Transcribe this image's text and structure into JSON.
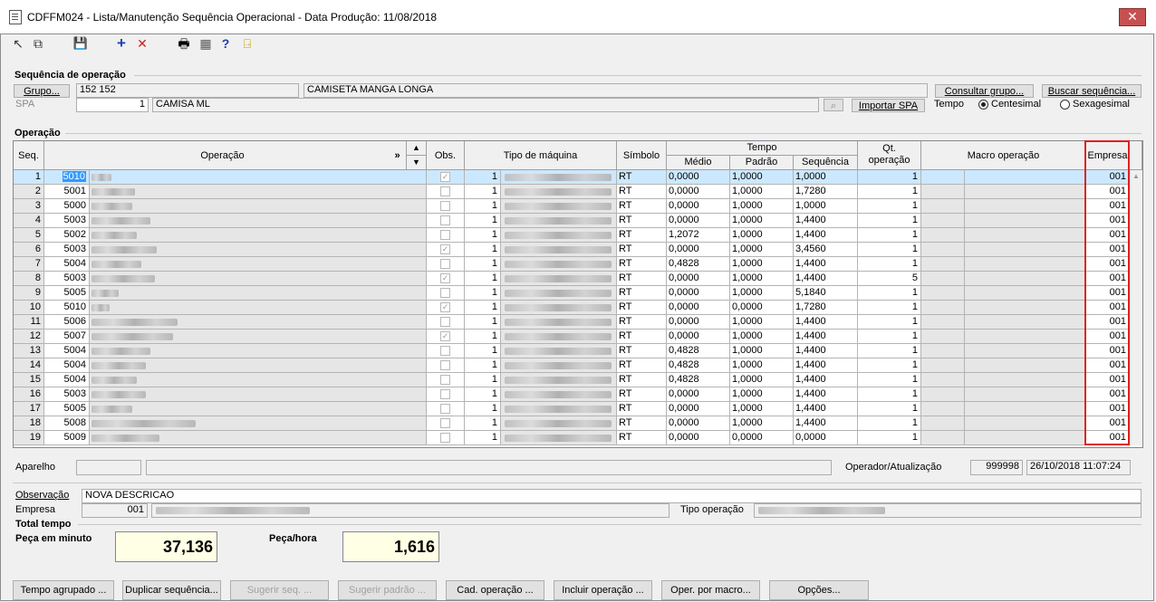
{
  "window": {
    "title": "CDFFM024 - Lista/Manutenção Sequência Operacional - Data Produção: 11/08/2018",
    "close": "✕"
  },
  "toolbar": [
    {
      "icon": "export-icon",
      "glyph": "↖"
    },
    {
      "icon": "copy-icon",
      "glyph": "⧉"
    },
    {
      "icon": "save-icon",
      "glyph": "💾"
    },
    {
      "icon": "add-icon",
      "glyph": "+"
    },
    {
      "icon": "delete-icon",
      "glyph": "✕"
    },
    {
      "icon": "print-icon",
      "glyph": "🖶"
    },
    {
      "icon": "calculator-icon",
      "glyph": "▦"
    },
    {
      "icon": "help-icon",
      "glyph": "?"
    },
    {
      "icon": "exit-icon",
      "glyph": "⍈"
    }
  ],
  "seq_section": {
    "title": "Sequência de operação",
    "grupo_btn": "Grupo...",
    "grupo_code": "152 152",
    "grupo_desc": "CAMISETA MANGA LONGA",
    "consultar_btn": "Consultar grupo...",
    "buscar_btn": "Buscar sequência...",
    "spa_label": "SPA",
    "spa_value": "1",
    "spa_desc": "CAMISA ML",
    "importar_btn": "Importar SPA",
    "tempo_label": "Tempo",
    "radio_centesimal": "Centesimal",
    "radio_sexagesimal": "Sexagesimal"
  },
  "operacao_section": {
    "title": "Operação",
    "headers": {
      "seq": "Seq.",
      "operacao": "Operação",
      "expand": "»",
      "up": "▲",
      "down": "▼",
      "obs": "Obs.",
      "tipo_maquina": "Tipo de máquina",
      "simbolo": "Símbolo",
      "tempo": "Tempo",
      "medio": "Médio",
      "padrao": "Padrão",
      "sequencia": "Sequência",
      "qt_operacao_1": "Qt.",
      "qt_operacao_2": "operação",
      "macro": "Macro operação",
      "empresa": "Empresa"
    },
    "rows": [
      {
        "seq": "1",
        "cod": "5010",
        "obs": true,
        "tipo": "1",
        "sim": "RT",
        "medio": "0,0000",
        "padrao": "1,0000",
        "sequencia": "1,0000",
        "qt": "1",
        "empresa": "001"
      },
      {
        "seq": "2",
        "cod": "5001",
        "obs": false,
        "tipo": "1",
        "sim": "RT",
        "medio": "0,0000",
        "padrao": "1,0000",
        "sequencia": "1,7280",
        "qt": "1",
        "empresa": "001"
      },
      {
        "seq": "3",
        "cod": "5000",
        "obs": false,
        "tipo": "1",
        "sim": "RT",
        "medio": "0,0000",
        "padrao": "1,0000",
        "sequencia": "1,0000",
        "qt": "1",
        "empresa": "001"
      },
      {
        "seq": "4",
        "cod": "5003",
        "obs": false,
        "tipo": "1",
        "sim": "RT",
        "medio": "0,0000",
        "padrao": "1,0000",
        "sequencia": "1,4400",
        "qt": "1",
        "empresa": "001"
      },
      {
        "seq": "5",
        "cod": "5002",
        "obs": false,
        "tipo": "1",
        "sim": "RT",
        "medio": "1,2072",
        "padrao": "1,0000",
        "sequencia": "1,4400",
        "qt": "1",
        "empresa": "001"
      },
      {
        "seq": "6",
        "cod": "5003",
        "obs": true,
        "tipo": "1",
        "sim": "RT",
        "medio": "0,0000",
        "padrao": "1,0000",
        "sequencia": "3,4560",
        "qt": "1",
        "empresa": "001"
      },
      {
        "seq": "7",
        "cod": "5004",
        "obs": false,
        "tipo": "1",
        "sim": "RT",
        "medio": "0,4828",
        "padrao": "1,0000",
        "sequencia": "1,4400",
        "qt": "1",
        "empresa": "001"
      },
      {
        "seq": "8",
        "cod": "5003",
        "obs": true,
        "tipo": "1",
        "sim": "RT",
        "medio": "0,0000",
        "padrao": "1,0000",
        "sequencia": "1,4400",
        "qt": "5",
        "empresa": "001"
      },
      {
        "seq": "9",
        "cod": "5005",
        "obs": false,
        "tipo": "1",
        "sim": "RT",
        "medio": "0,0000",
        "padrao": "1,0000",
        "sequencia": "5,1840",
        "qt": "1",
        "empresa": "001"
      },
      {
        "seq": "10",
        "cod": "5010",
        "obs": true,
        "tipo": "1",
        "sim": "RT",
        "medio": "0,0000",
        "padrao": "0,0000",
        "sequencia": "1,7280",
        "qt": "1",
        "empresa": "001"
      },
      {
        "seq": "11",
        "cod": "5006",
        "obs": false,
        "tipo": "1",
        "sim": "RT",
        "medio": "0,0000",
        "padrao": "1,0000",
        "sequencia": "1,4400",
        "qt": "1",
        "empresa": "001"
      },
      {
        "seq": "12",
        "cod": "5007",
        "obs": true,
        "tipo": "1",
        "sim": "RT",
        "medio": "0,0000",
        "padrao": "1,0000",
        "sequencia": "1,4400",
        "qt": "1",
        "empresa": "001"
      },
      {
        "seq": "13",
        "cod": "5004",
        "obs": false,
        "tipo": "1",
        "sim": "RT",
        "medio": "0,4828",
        "padrao": "1,0000",
        "sequencia": "1,4400",
        "qt": "1",
        "empresa": "001"
      },
      {
        "seq": "14",
        "cod": "5004",
        "obs": false,
        "tipo": "1",
        "sim": "RT",
        "medio": "0,4828",
        "padrao": "1,0000",
        "sequencia": "1,4400",
        "qt": "1",
        "empresa": "001"
      },
      {
        "seq": "15",
        "cod": "5004",
        "obs": false,
        "tipo": "1",
        "sim": "RT",
        "medio": "0,4828",
        "padrao": "1,0000",
        "sequencia": "1,4400",
        "qt": "1",
        "empresa": "001"
      },
      {
        "seq": "16",
        "cod": "5003",
        "obs": false,
        "tipo": "1",
        "sim": "RT",
        "medio": "0,0000",
        "padrao": "1,0000",
        "sequencia": "1,4400",
        "qt": "1",
        "empresa": "001"
      },
      {
        "seq": "17",
        "cod": "5005",
        "obs": false,
        "tipo": "1",
        "sim": "RT",
        "medio": "0,0000",
        "padrao": "1,0000",
        "sequencia": "1,4400",
        "qt": "1",
        "empresa": "001"
      },
      {
        "seq": "18",
        "cod": "5008",
        "obs": false,
        "tipo": "1",
        "sim": "RT",
        "medio": "0,0000",
        "padrao": "1,0000",
        "sequencia": "1,4400",
        "qt": "1",
        "empresa": "001"
      },
      {
        "seq": "19",
        "cod": "5009",
        "obs": false,
        "tipo": "1",
        "sim": "RT",
        "medio": "0,0000",
        "padrao": "0,0000",
        "sequencia": "0,0000",
        "qt": "1",
        "empresa": "001"
      }
    ]
  },
  "aparelho_label": "Aparelho",
  "operador_label": "Operador/Atualização",
  "operador_value": "999998",
  "atualizacao_value": "26/10/2018 11:07:24",
  "observacao_label": "Observação",
  "observacao_value": "NOVA DESCRICAO",
  "empresa_label": "Empresa",
  "empresa_value": "001",
  "tipo_operacao_label": "Tipo operação",
  "total_title": "Total tempo",
  "peca_minuto_label": "Peça em minuto",
  "peca_minuto_value": "37,136",
  "peca_hora_label": "Peça/hora",
  "peca_hora_value": "1,616",
  "bottom_buttons": [
    {
      "label": "Tempo agrupado ...",
      "enabled": true
    },
    {
      "label": "Duplicar sequência...",
      "enabled": true
    },
    {
      "label": "Sugerir seq. ...",
      "enabled": false
    },
    {
      "label": "Sugerir padrão ...",
      "enabled": false
    },
    {
      "label": "Cad. operação ...",
      "enabled": true
    },
    {
      "label": "Incluir operação ...",
      "enabled": true
    },
    {
      "label": "Oper. por macro...",
      "enabled": true
    },
    {
      "label": "Opções...",
      "enabled": true
    }
  ],
  "colors": {
    "selected_row": "#cce8ff",
    "highlight_box": "#e02020",
    "total_bg": "#ffffe6",
    "close_btn": "#c75050"
  }
}
